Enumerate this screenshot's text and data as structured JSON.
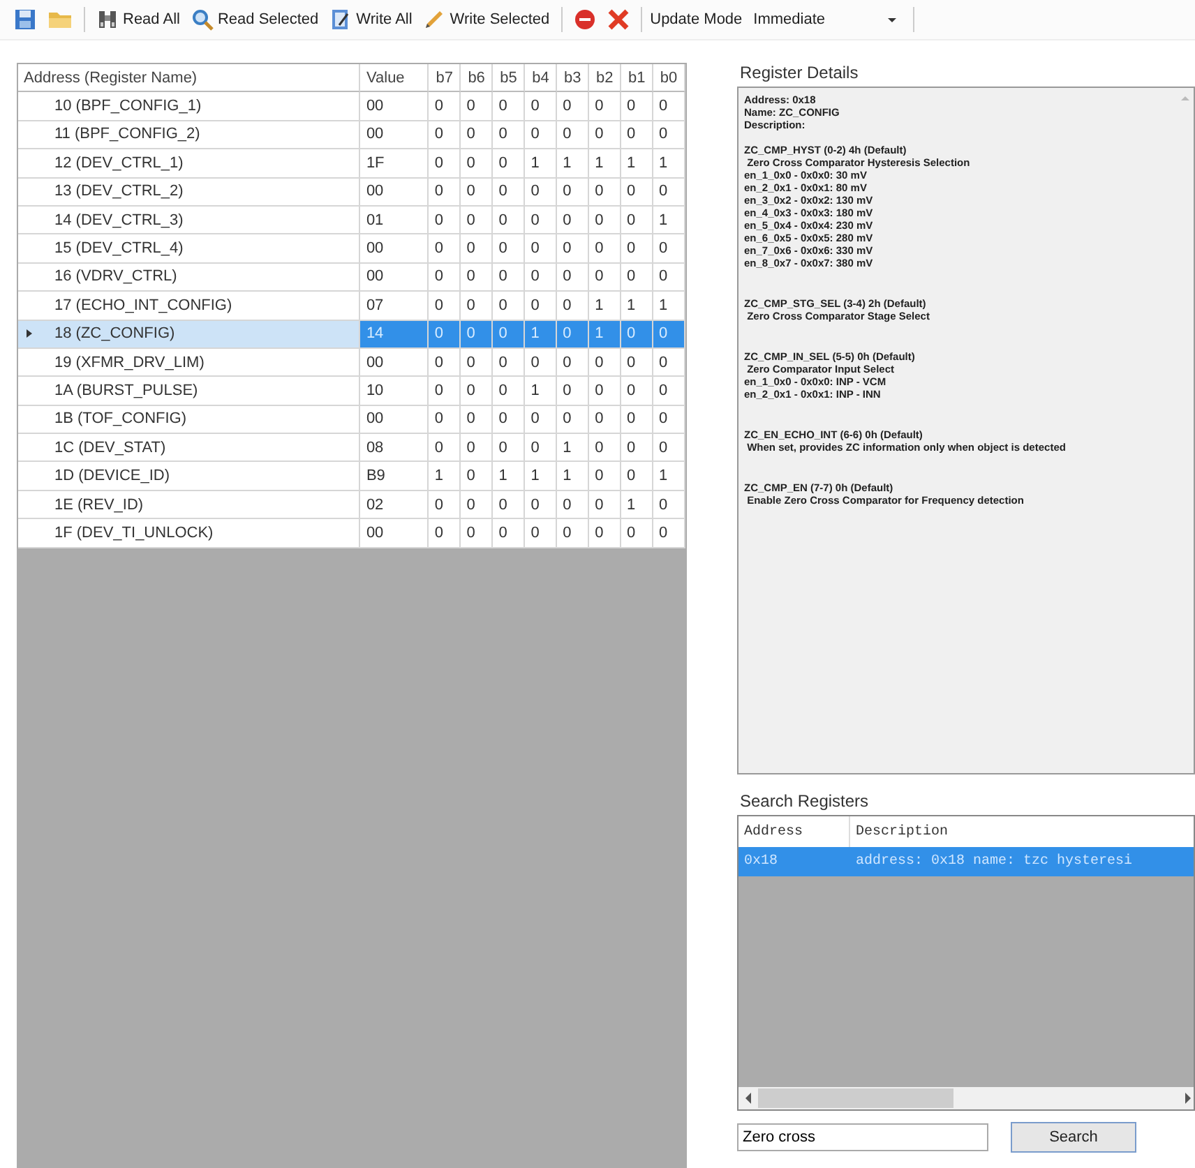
{
  "toolbar": {
    "buttons": [
      {
        "kind": "save"
      },
      {
        "kind": "open"
      },
      {
        "kind": "read_all",
        "label": "Read All"
      },
      {
        "kind": "read_selected",
        "label": "Read Selected"
      },
      {
        "kind": "write_all",
        "label": "Write All"
      },
      {
        "kind": "write_selected",
        "label": "Write Selected"
      },
      {
        "kind": "stop"
      },
      {
        "kind": "cancel"
      }
    ],
    "update_mode_label": "Update Mode",
    "update_mode_value": "Immediate"
  },
  "register_grid": {
    "columns": [
      "Address (Register Name)",
      "Value",
      "b7",
      "b6",
      "b5",
      "b4",
      "b3",
      "b2",
      "b1",
      "b0"
    ],
    "rows": [
      {
        "name": "10 (BPF_CONFIG_1)",
        "value": "00",
        "bits": [
          "0",
          "0",
          "0",
          "0",
          "0",
          "0",
          "0",
          "0"
        ],
        "selected": false
      },
      {
        "name": "11 (BPF_CONFIG_2)",
        "value": "00",
        "bits": [
          "0",
          "0",
          "0",
          "0",
          "0",
          "0",
          "0",
          "0"
        ],
        "selected": false
      },
      {
        "name": "12 (DEV_CTRL_1)",
        "value": "1F",
        "bits": [
          "0",
          "0",
          "0",
          "1",
          "1",
          "1",
          "1",
          "1"
        ],
        "selected": false
      },
      {
        "name": "13 (DEV_CTRL_2)",
        "value": "00",
        "bits": [
          "0",
          "0",
          "0",
          "0",
          "0",
          "0",
          "0",
          "0"
        ],
        "selected": false
      },
      {
        "name": "14 (DEV_CTRL_3)",
        "value": "01",
        "bits": [
          "0",
          "0",
          "0",
          "0",
          "0",
          "0",
          "0",
          "1"
        ],
        "selected": false
      },
      {
        "name": "15 (DEV_CTRL_4)",
        "value": "00",
        "bits": [
          "0",
          "0",
          "0",
          "0",
          "0",
          "0",
          "0",
          "0"
        ],
        "selected": false
      },
      {
        "name": "16 (VDRV_CTRL)",
        "value": "00",
        "bits": [
          "0",
          "0",
          "0",
          "0",
          "0",
          "0",
          "0",
          "0"
        ],
        "selected": false
      },
      {
        "name": "17 (ECHO_INT_CONFIG)",
        "value": "07",
        "bits": [
          "0",
          "0",
          "0",
          "0",
          "0",
          "1",
          "1",
          "1"
        ],
        "selected": false
      },
      {
        "name": "18 (ZC_CONFIG)",
        "value": "14",
        "bits": [
          "0",
          "0",
          "0",
          "1",
          "0",
          "1",
          "0",
          "0"
        ],
        "selected": true
      },
      {
        "name": "19 (XFMR_DRV_LIM)",
        "value": "00",
        "bits": [
          "0",
          "0",
          "0",
          "0",
          "0",
          "0",
          "0",
          "0"
        ],
        "selected": false
      },
      {
        "name": "1A (BURST_PULSE)",
        "value": "10",
        "bits": [
          "0",
          "0",
          "0",
          "1",
          "0",
          "0",
          "0",
          "0"
        ],
        "selected": false
      },
      {
        "name": "1B (TOF_CONFIG)",
        "value": "00",
        "bits": [
          "0",
          "0",
          "0",
          "0",
          "0",
          "0",
          "0",
          "0"
        ],
        "selected": false
      },
      {
        "name": "1C (DEV_STAT)",
        "value": "08",
        "bits": [
          "0",
          "0",
          "0",
          "0",
          "1",
          "0",
          "0",
          "0"
        ],
        "selected": false
      },
      {
        "name": "1D (DEVICE_ID)",
        "value": "B9",
        "bits": [
          "1",
          "0",
          "1",
          "1",
          "1",
          "0",
          "0",
          "1"
        ],
        "selected": false
      },
      {
        "name": "1E (REV_ID)",
        "value": "02",
        "bits": [
          "0",
          "0",
          "0",
          "0",
          "0",
          "0",
          "1",
          "0"
        ],
        "selected": false
      },
      {
        "name": "1F (DEV_TI_UNLOCK)",
        "value": "00",
        "bits": [
          "0",
          "0",
          "0",
          "0",
          "0",
          "0",
          "0",
          "0"
        ],
        "selected": false
      }
    ]
  },
  "register_details": {
    "title": "Register Details",
    "sections": [
      [
        "Address: 0x18",
        "Name: ZC_CONFIG",
        "Description:"
      ],
      [
        "ZC_CMP_HYST (0-2) 4h (Default)",
        " Zero Cross Comparator Hysteresis Selection",
        "en_1_0x0 - 0x0x0: 30 mV",
        "en_2_0x1 - 0x0x1: 80 mV",
        "en_3_0x2 - 0x0x2: 130 mV",
        "en_4_0x3 - 0x0x3: 180 mV",
        "en_5_0x4 - 0x0x4: 230 mV",
        "en_6_0x5 - 0x0x5: 280 mV",
        "en_7_0x6 - 0x0x6: 330 mV",
        "en_8_0x7 - 0x0x7: 380 mV"
      ],
      [
        "ZC_CMP_STG_SEL (3-4) 2h (Default)",
        " Zero Cross Comparator Stage Select"
      ],
      [
        "ZC_CMP_IN_SEL (5-5) 0h (Default)",
        " Zero Comparator Input Select",
        "en_1_0x0 - 0x0x0: INP - VCM",
        "en_2_0x1 - 0x0x1: INP - INN"
      ],
      [
        "ZC_EN_ECHO_INT (6-6) 0h (Default)",
        " When set, provides ZC information only when object is detected"
      ],
      [
        "ZC_CMP_EN (7-7) 0h (Default)",
        " Enable Zero Cross Comparator for Frequency detection"
      ]
    ]
  },
  "search_registers": {
    "title": "Search Registers",
    "columns": [
      "Address",
      "Description"
    ],
    "results": [
      {
        "address": "0x18",
        "description": "address: 0x18 name: tzc hysteresi",
        "selected": true
      }
    ],
    "query": "Zero cross",
    "search_button": "Search"
  }
}
